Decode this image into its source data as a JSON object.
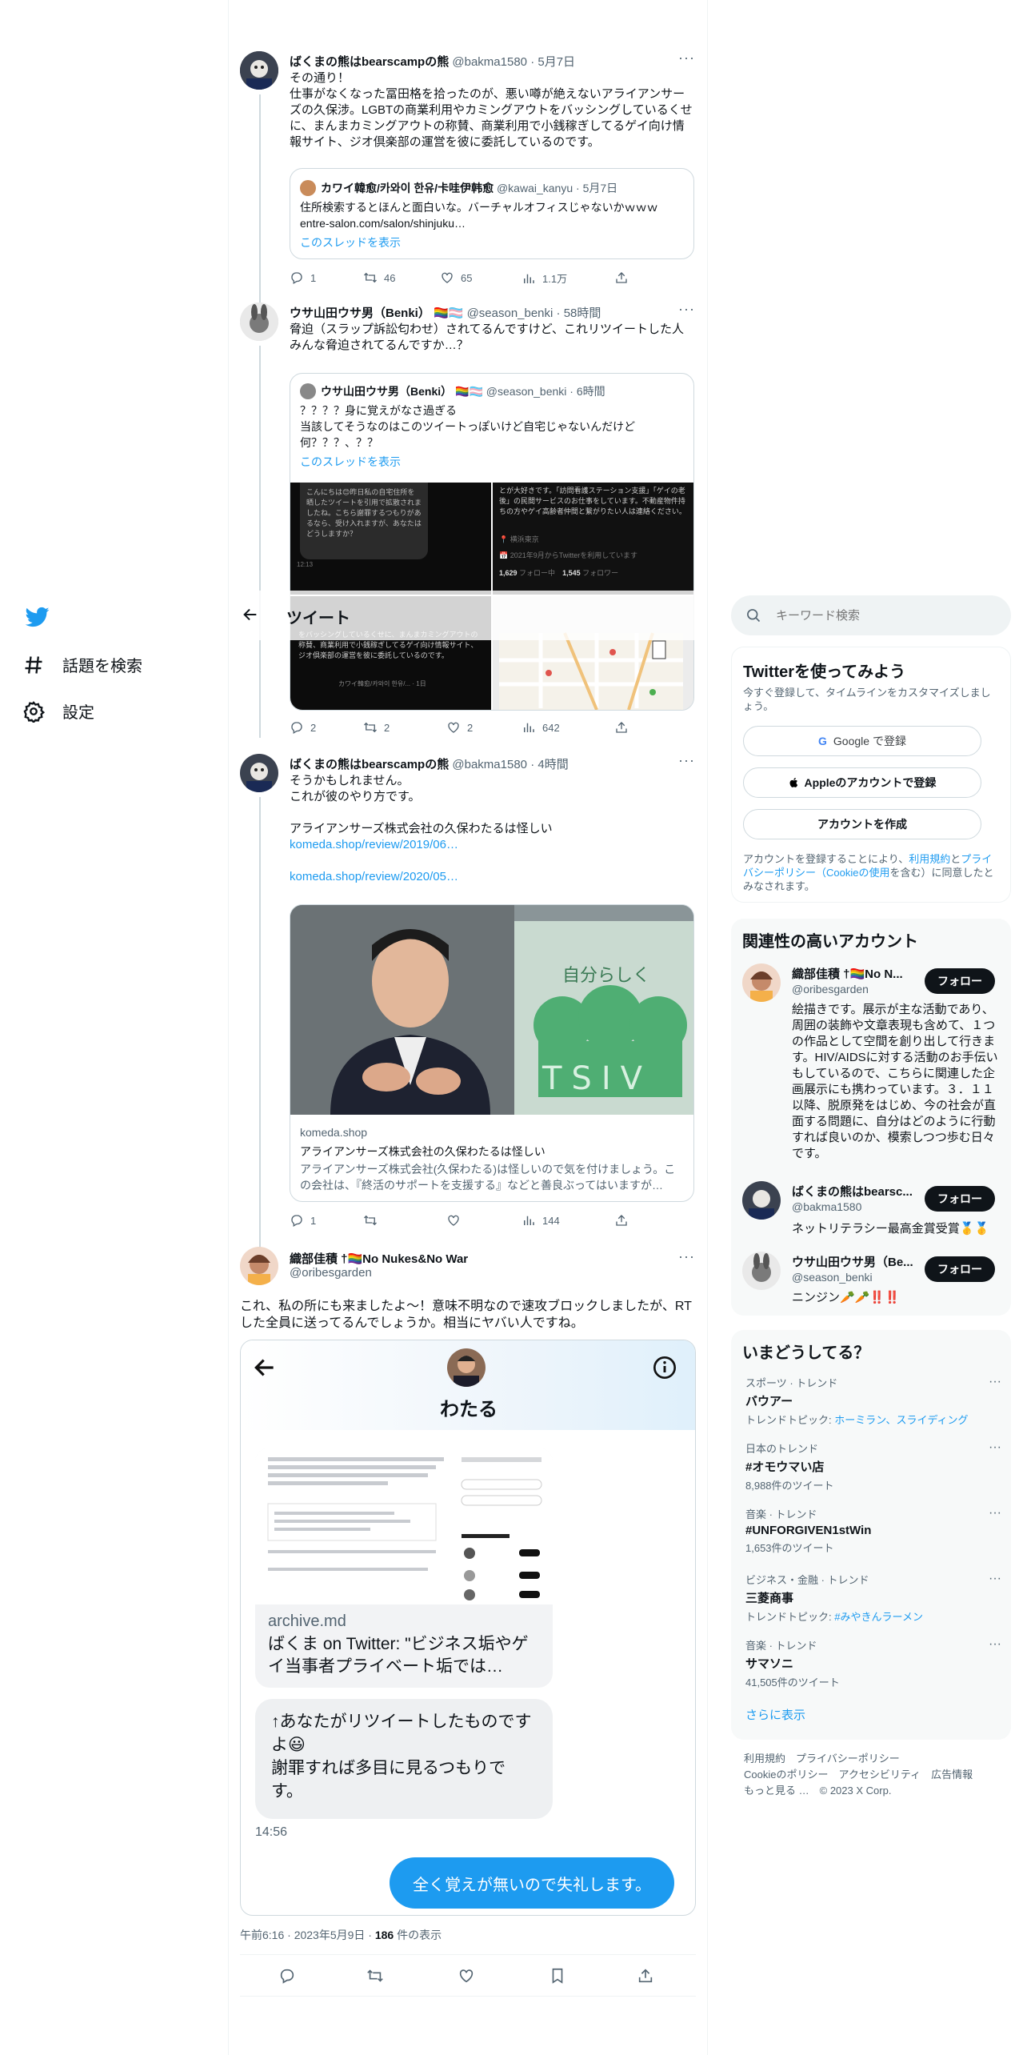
{
  "nav": {
    "topics": "話題を検索",
    "settings": "設定"
  },
  "sticky_header": {
    "title": "ツイート"
  },
  "search": {
    "placeholder": "キーワード検索"
  },
  "tweet1": {
    "name": "ばくまの熊はbearscampの熊",
    "handle": "@bakma1580",
    "date": "· 5月7日",
    "text": "その通り！\n仕事がなくなった冨田格を拾ったのが、悪い噂が絶えないアライアンサーズの久保涉。LGBTの商業利用やカミングアウトをバッシングしているくせに、まんまカミングアウトの称賛、商業利用で小銭稼ぎしてるゲイ向け情報サイト、ジオ倶楽部の運営を彼に委託しているのです。",
    "quote": {
      "name": "カワイ韓愈/카와이 한유/卡哇伊韩愈",
      "handle": "@kawai_kanyu",
      "date": "· 5月7日",
      "text": "住所検索するとほんと面白いな。バーチャルオフィスじゃないかｗｗｗ\nentre-salon.com/salon/shinjuku…",
      "show_thread": "このスレッドを表示"
    },
    "replies": "1",
    "retweets": "46",
    "likes": "65",
    "views": "1.1万"
  },
  "tweet2": {
    "name": "ウサ山田ウサ男（Benki）",
    "handle": "@season_benki",
    "date": "· 58時間",
    "text": "脅迫（スラップ訴訟匂わせ）されてるんですけど、これリツイートした人みんな脅迫されてるんですか…？",
    "quote": {
      "name": "ウサ山田ウサ男（Benki）",
      "handle": "@season_benki",
      "date": "· 6時間",
      "text": "？？？？身に覚えがなさ過ぎる\n当該してそうなのはこのツイートっぽいけど自宅じゃないんだけど\n何？？？、？？",
      "show_thread": "このスレッドを表示",
      "img1_text": "こんにちは😊昨日私の自宅住所を晒したツイートを引用で拡散されましたね。こちら謝罪するつもりがあるなら、受け入れますが、あなたはどうしますか？",
      "img1_time": "12:13",
      "img2_text": "とが大好きです。「訪問看護ステーション支援」「ゲイの老後」の民間サービスのお仕事をしています。不動産物件持ちの方やゲイ高齢者仲間と繋がりたい人は連絡ください。",
      "img2_loc": "横浜東京",
      "img2_joined": "2021年9月からTwitterを利用しています",
      "img2_following": "1,629",
      "img2_following_label": "フォロー中",
      "img2_followers": "1,545",
      "img2_followers_label": "フォロワー",
      "img3_text": "をバッシングしているくせに、まんまカミングアウトの称賛、商業利用で小銭稼ぎしてるゲイ向け情報サイト、ジオ倶楽部の運営を彼に委託しているのです。",
      "img3_quote": "カワイ韓愈/카와이 한유/... · 1日"
    },
    "replies": "2",
    "retweets": "2",
    "likes": "2",
    "views": "642"
  },
  "tweet3": {
    "name": "ばくまの熊はbearscampの熊",
    "handle": "@bakma1580",
    "date": "· 4時間",
    "line1": "そうかもしれません。",
    "line2": "これが彼のやり方です。",
    "line3": "アライアンサーズ株式会社の久保わたるは怪しい",
    "link1": "komeda.shop/review/2019/06…",
    "link2": "komeda.shop/review/2020/05…",
    "card_sign": "自分らしく",
    "card_logo": "TSIV",
    "card_domain": "komeda.shop",
    "card_title": "アライアンサーズ株式会社の久保わたるは怪しい",
    "card_desc": "アライアンサーズ株式会社(久保わたる)は怪しいので気を付けましょう。この会社は、『終活のサポートを支援する』などと善良ぶってはいますが…",
    "replies": "1",
    "retweets": "",
    "likes": "",
    "views": "144"
  },
  "main": {
    "name": "織部佳積 †🏳️‍🌈No Nukes&No War",
    "handle": "@oribesgarden",
    "text": "これ、私の所にも来ましたよ〜！意味不明なので速攻ブロックしましたが、RTした全員に送ってるんでしょうか。相当にヤバい人ですね。",
    "dm": {
      "contact": "わたる",
      "link_domain": "archive.md",
      "link_title": "ばくま on Twitter: \"ビジネス垢やゲイ当事者プライベート垢では…",
      "message": "↑あなたがリツイートしたものですよ😃\n謝罪すれば多目に見るつもりです。",
      "time": "14:56",
      "reply": "全く覚えが無いので失礼します。"
    },
    "timestamp": "午前6:16 · 2023年5月9日 · ",
    "view_count": "186",
    "view_label": " 件の表示"
  },
  "signup": {
    "title": "Twitterを使ってみよう",
    "subtitle": "今すぐ登録して、タイムラインをカスタマイズしましょう。",
    "google": "Google で登録",
    "apple": "Appleのアカウントで登録",
    "create": "アカウントを作成",
    "legal_prefix": "アカウントを登録することにより、",
    "legal_terms": "利用規約",
    "legal_and": "と",
    "legal_privacy": "プライバシーポリシー",
    "legal_cookie": "（Cookieの使用",
    "legal_suffix": "を含む）に同意したとみなされます。"
  },
  "relevant": {
    "title": "関連性の高いアカウント",
    "follow_label": "フォロー",
    "accounts": [
      {
        "name": "織部佳積 †🏳️‍🌈No N...",
        "handle": "@oribesgarden",
        "bio": "絵描きです。展示が主な活動であり、周囲の装飾や文章表現も含めて、１つの作品として空間を創り出して行きます。HIV/AIDSに対する活動のお手伝いもしているので、こちらに関連した企画展示にも携わっています。３．１１以降、脱原発をはじめ、今の社会が直面する問題に、自分はどのように行動すれば良いのか、模索しつつ歩む日々です。"
      },
      {
        "name": "ばくまの熊はbearsc...",
        "handle": "@bakma1580",
        "bio": "ネットリテラシー最高金賞受賞🥇🥇"
      },
      {
        "name": "ウサ山田ウサ男（Be...",
        "handle": "@season_benki",
        "bio": "ニンジン🥕🥕‼️‼️"
      }
    ]
  },
  "trends": {
    "title": "いまどうしてる？",
    "items": [
      {
        "category": "スポーツ · トレンド",
        "name": "バウアー",
        "extra_prefix": "トレンドトピック: ",
        "extra_link": "ホーミラン、スライディング"
      },
      {
        "category": "日本のトレンド",
        "name": "#オモウマい店",
        "count": "8,988件のツイート"
      },
      {
        "category": "音楽 · トレンド",
        "name": "#UNFORGIVEN1stWin",
        "count": "1,653件のツイート"
      },
      {
        "category": "ビジネス・金融 · トレンド",
        "name": "三菱商事",
        "extra_prefix": "トレンドトピック: ",
        "extra_link": "#みやきんラーメン"
      },
      {
        "category": "音楽 · トレンド",
        "name": "サマソニ",
        "count": "41,505件のツイート"
      }
    ],
    "show_more": "さらに表示"
  },
  "footer": {
    "terms": "利用規約",
    "privacy": "プライバシーポリシー",
    "cookie": "Cookieのポリシー",
    "accessibility": "アクセシビリティ",
    "ads": "広告情報",
    "more": "もっと見る …",
    "copyright": "© 2023 X Corp."
  }
}
